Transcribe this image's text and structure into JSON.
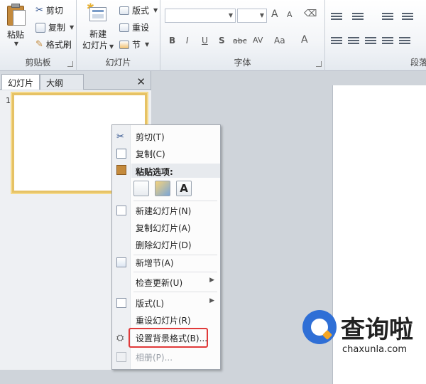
{
  "ribbon": {
    "clipboard": {
      "paste_label": "粘贴",
      "cut_label": "剪切",
      "copy_label": "复制",
      "format_painter_label": "格式刷",
      "group_label": "剪贴板"
    },
    "slides": {
      "new_slide_label": "新建",
      "new_slide_label2": "幻灯片",
      "layout_label": "版式",
      "reset_label": "重设",
      "section_label": "节",
      "group_label": "幻灯片"
    },
    "font": {
      "group_label": "字体",
      "bold": "B",
      "italic": "I",
      "underline": "U",
      "strike": "S",
      "strike_label": "abc",
      "spacing": "AV",
      "case": "Aa",
      "color": "A",
      "grow": "A",
      "shrink": "A"
    },
    "paragraph": {
      "group_label": "段落"
    }
  },
  "left_pane": {
    "tabs": [
      "幻灯片",
      "大纲"
    ],
    "close": "✕",
    "slide_number": "1"
  },
  "context_menu": {
    "items": [
      {
        "label": "剪切(T)",
        "icon": "scissors-icon"
      },
      {
        "label": "复制(C)",
        "icon": "copy-icon"
      },
      {
        "label": "粘贴选项:",
        "icon": "paste-icon"
      },
      {
        "label": "新建幻灯片(N)",
        "icon": "new-slide-icon"
      },
      {
        "label": "复制幻灯片(A)"
      },
      {
        "label": "删除幻灯片(D)"
      },
      {
        "label": "新增节(A)",
        "icon": "section-icon"
      },
      {
        "label": "检查更新(U)",
        "submenu": "▶"
      },
      {
        "label": "版式(L)",
        "icon": "layout-icon",
        "submenu": "▶"
      },
      {
        "label": "重设幻灯片(R)"
      },
      {
        "label": "设置背景格式(B)...",
        "icon": "background-icon"
      },
      {
        "label": "相册(P)...",
        "icon": "album-icon",
        "disabled": true
      }
    ],
    "paste_options": [
      "A"
    ]
  },
  "watermark": {
    "brand": "查询啦",
    "url": "chaxunla.com"
  },
  "colors": {
    "accent": "#2f6fd6",
    "highlight": "#e03a3a",
    "thumb_border": "#e6c265"
  }
}
